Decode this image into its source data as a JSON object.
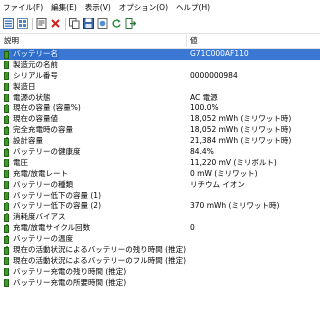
{
  "menu": [
    "ファイル(F)",
    "編集(E)",
    "表示(V)",
    "オプション(O)",
    "ヘルプ(H)"
  ],
  "toolbar": {
    "icons": [
      "details-view-icon",
      "list-view-icon",
      "properties-icon",
      "delete-icon",
      "copy-icon",
      "save-icon",
      "html-report-icon",
      "refresh-icon",
      "exit-icon"
    ]
  },
  "columns": {
    "name": "説明",
    "value": "値"
  },
  "accent_color": "#3e9b27",
  "selection_color": "#3a78d4",
  "rows": [
    {
      "label": "バッテリー名",
      "value": "G71C000AF110"
    },
    {
      "label": "製造元の名前",
      "value": ""
    },
    {
      "label": "シリアル番号",
      "value": "0000000984"
    },
    {
      "label": "製造日",
      "value": ""
    },
    {
      "label": "電源の状態",
      "value": "AC 電源"
    },
    {
      "label": "現在の容量 (容量%)",
      "value": "100.0%"
    },
    {
      "label": "現在の容量値",
      "value": "18,052 mWh (ミリワット時)"
    },
    {
      "label": "完全充電時の容量",
      "value": "18,052 mWh (ミリワット時)"
    },
    {
      "label": "設計容量",
      "value": "21,384 mWh (ミリワット時)"
    },
    {
      "label": "バッテリーの健康度",
      "value": "84.4%"
    },
    {
      "label": "電圧",
      "value": "11,220 mV (ミリボルト)"
    },
    {
      "label": "充電/放電レート",
      "value": "0 mW (ミリワット)"
    },
    {
      "label": "バッテリーの種類",
      "value": "リチウム イオン"
    },
    {
      "label": "バッテリー低下の容量 (1)",
      "value": ""
    },
    {
      "label": "バッテリー低下の容量 (2)",
      "value": "370 mWh (ミリワット時)"
    },
    {
      "label": "消耗度バイアス",
      "value": ""
    },
    {
      "label": "充電/放電サイクル回数",
      "value": "0"
    },
    {
      "label": "バッテリーの温度",
      "value": ""
    },
    {
      "label": "現在の活動状況によるバッテリーの残り時間 (推定)",
      "value": ""
    },
    {
      "label": "現在の活動状況によるバッテリーのフル時間 (推定)",
      "value": ""
    },
    {
      "label": "バッテリー充電の残り時間 (推定)",
      "value": ""
    },
    {
      "label": "バッテリー充電の所要時間 (推定)",
      "value": ""
    }
  ]
}
